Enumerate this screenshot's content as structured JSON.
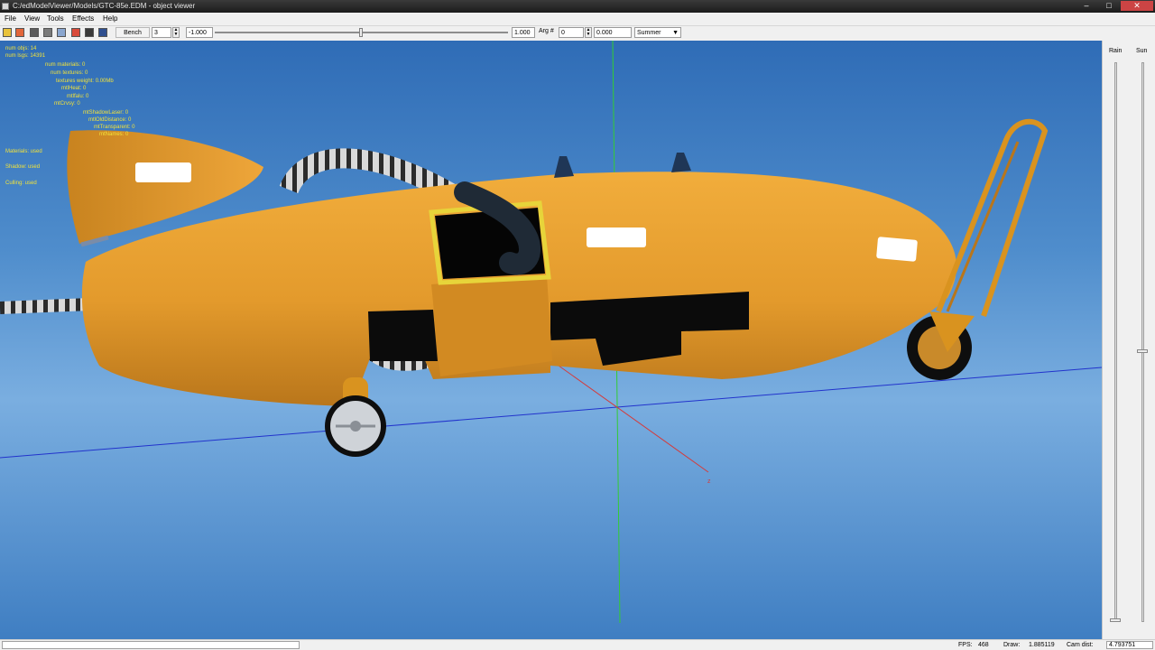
{
  "window": {
    "title": "C:/edModelViewer/Models/GTC-85e.EDM - object viewer",
    "min_glyph": "–",
    "max_glyph": "□",
    "close_glyph": "✕"
  },
  "menu": {
    "items": [
      "File",
      "View",
      "Tools",
      "Effects",
      "Help"
    ]
  },
  "toolbar": {
    "icons": [
      "open-icon",
      "model-icon",
      "camera-icon",
      "camera-icon",
      "grid-icon",
      "figure-icon",
      "export-icon",
      "screen-icon"
    ],
    "bench_label": "Bench",
    "bench_value": "3",
    "min_value": "-1.000",
    "max_value": "1.000",
    "arg_label": "Arg #",
    "arg_value": "0",
    "arg_float": "0.000",
    "season_value": "Summer",
    "dropdown_glyph": "▼",
    "spin_up": "▲",
    "spin_down": "▼"
  },
  "stats": {
    "lines": [
      "num objs: 14",
      "num lsgs: 14391",
      "num materials: 0",
      "num textures: 0",
      "textures weight: 0.00Mb",
      "mtlHeat: 0",
      "mtlfalu: 0",
      "mtCrvsy: 0",
      "mtShadowLaser: 0",
      "mtlOldDistance: 0",
      "mtTransparent: 0",
      "mtNames: 0",
      "Materials: used",
      "Shadow: used",
      "Culling: used"
    ],
    "color": "#f2e23a"
  },
  "scene": {
    "axis_z_label": "z",
    "model_color": "#e39a2c",
    "hatch_color": "#e7d43a"
  },
  "right_panel": {
    "rain_label": "Rain",
    "sun_label": "Sun",
    "rain_level": 0.0,
    "sun_level": 0.48
  },
  "status": {
    "fps_label": "FPS:",
    "fps_value": "468",
    "draw_label": "Draw:",
    "draw_value": "1.885119",
    "cam_label": "Cam dist:",
    "cam_value": "4.793751"
  }
}
